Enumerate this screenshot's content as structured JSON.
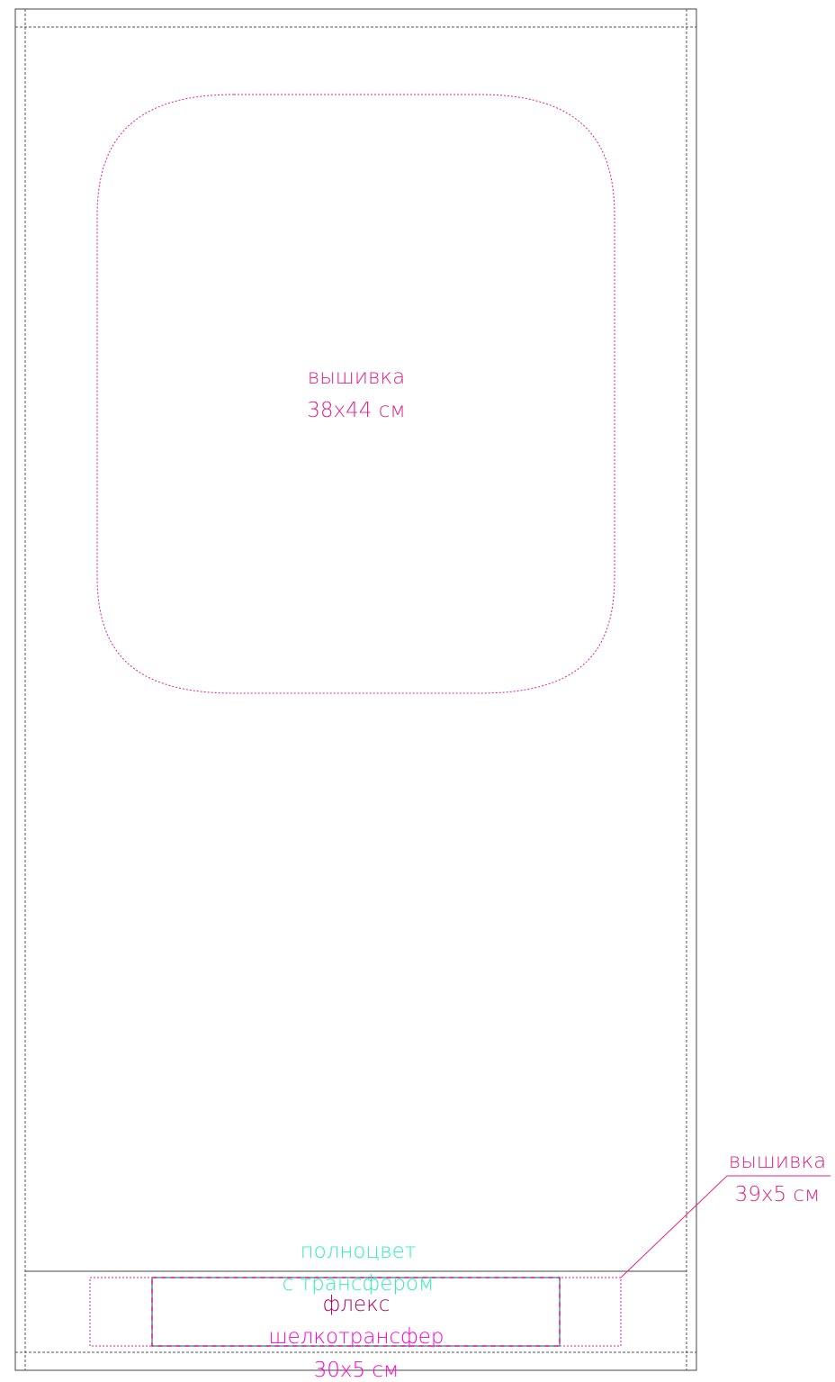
{
  "colors": {
    "outline": "#333333",
    "embroidery": "#e0218a",
    "fullcolor": "#2ff0b4",
    "flex": "#b1005c",
    "silk": "#ff00d0"
  },
  "zones": {
    "chest": {
      "method": "вышивка",
      "size": "38х44 см"
    },
    "hem_embroidery": {
      "method": "вышивка",
      "size": "39х5 см"
    },
    "hem_fullcolor": {
      "line1": "полноцвет",
      "line2": "с трансфером"
    },
    "hem_flex": {
      "method": "флекс"
    },
    "hem_silk": {
      "method": "шелкотрансфер",
      "size": "30х5 см"
    }
  }
}
